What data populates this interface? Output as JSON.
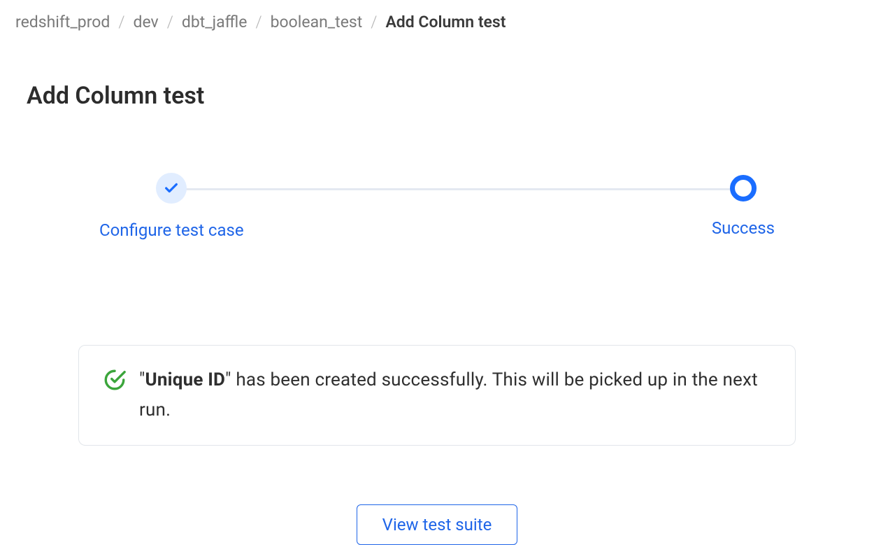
{
  "breadcrumb": {
    "items": [
      {
        "label": "redshift_prod"
      },
      {
        "label": "dev"
      },
      {
        "label": "dbt_jaffle"
      },
      {
        "label": "boolean_test"
      },
      {
        "label": "Add Column test"
      }
    ],
    "separator": "/"
  },
  "page": {
    "title": "Add Column test"
  },
  "stepper": {
    "steps": [
      {
        "label": "Configure test case",
        "state": "done"
      },
      {
        "label": "Success",
        "state": "current"
      }
    ]
  },
  "alert": {
    "quote_open": "\"",
    "name": "Unique ID",
    "quote_close": "\"",
    "rest": " has been created successfully. This will be picked up in the next run."
  },
  "actions": {
    "view_suite": "View test suite"
  }
}
